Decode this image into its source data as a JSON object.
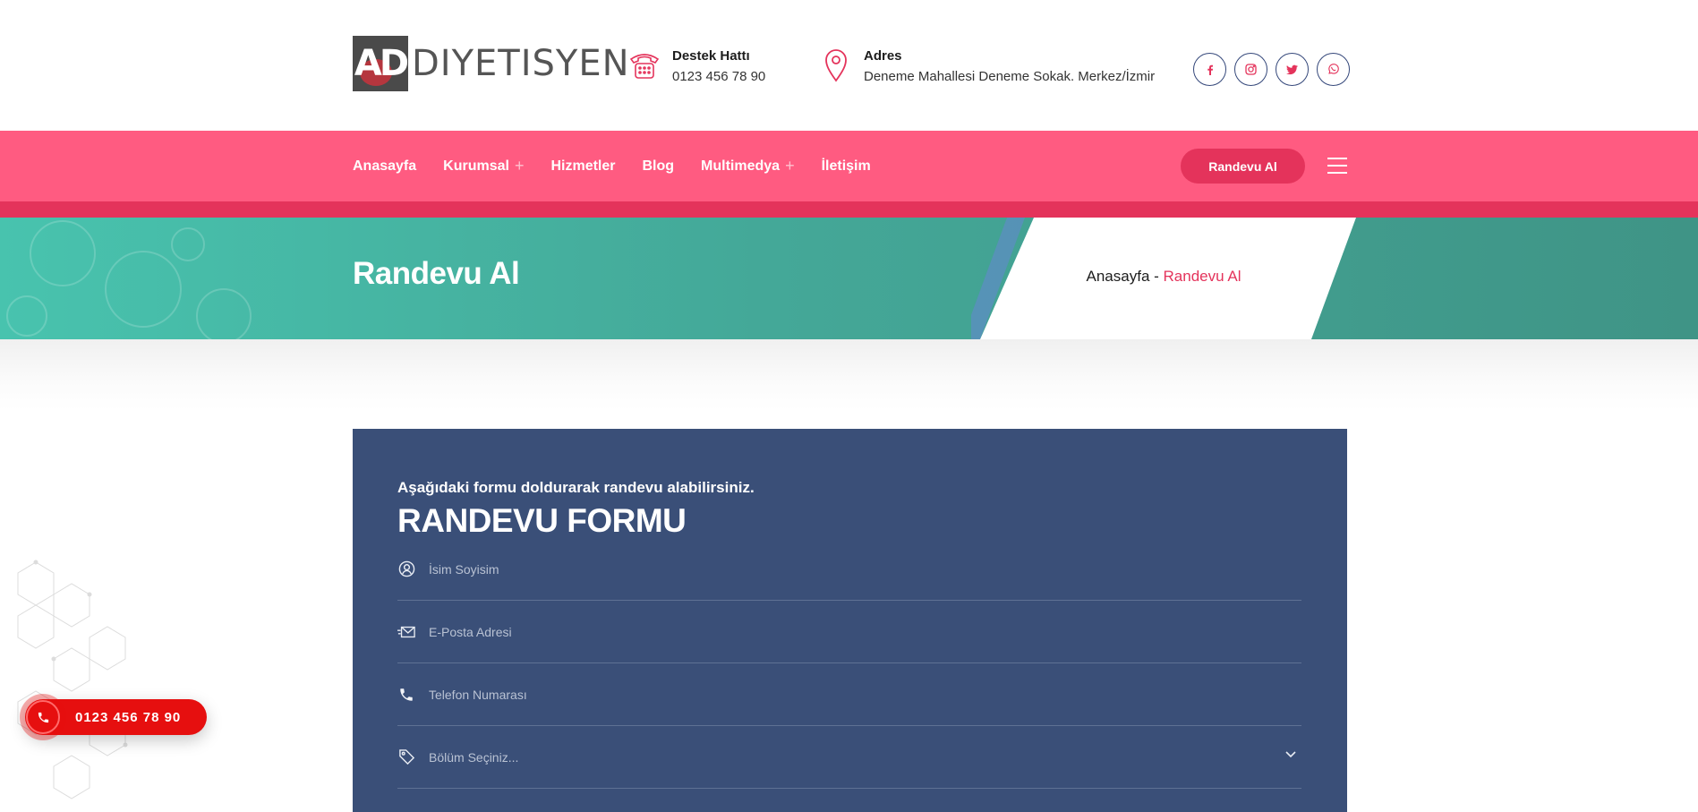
{
  "header": {
    "logo": {
      "mark": "AD",
      "text": "DIYETISYEN"
    },
    "support": {
      "title": "Destek Hattı",
      "value": "0123 456 78 90",
      "icon": "telephone-icon"
    },
    "address": {
      "title": "Adres",
      "value": "Deneme Mahallesi Deneme Sokak. Merkez/İzmir",
      "icon": "location-pin-icon"
    },
    "socials": [
      {
        "name": "facebook-icon",
        "glyph": "f"
      },
      {
        "name": "instagram-icon",
        "glyph": ""
      },
      {
        "name": "twitter-icon",
        "glyph": ""
      },
      {
        "name": "whatsapp-icon",
        "glyph": ""
      }
    ]
  },
  "nav": {
    "items": [
      {
        "label": "Anasayfa",
        "has_submenu": false
      },
      {
        "label": "Kurumsal",
        "has_submenu": true
      },
      {
        "label": "Hizmetler",
        "has_submenu": false
      },
      {
        "label": "Blog",
        "has_submenu": false
      },
      {
        "label": "Multimedya",
        "has_submenu": true
      },
      {
        "label": "İletişim",
        "has_submenu": false
      }
    ],
    "submenu_marker": "+",
    "cta_label": "Randevu Al"
  },
  "banner": {
    "title": "Randevu Al",
    "breadcrumb": {
      "home": "Anasayfa",
      "separator": " - ",
      "current": "Randevu Al"
    }
  },
  "form": {
    "subtitle": "Aşağıdaki formu doldurarak randevu alabilirsiniz.",
    "title": "RANDEVU FORMU",
    "fields": {
      "name": {
        "placeholder": "İsim Soyisim",
        "icon": "user-icon"
      },
      "email": {
        "placeholder": "E-Posta Adresi",
        "icon": "envelope-icon"
      },
      "phone": {
        "placeholder": "Telefon Numarası",
        "icon": "phone-icon"
      },
      "department": {
        "selected": "Bölüm Seçiniz...",
        "icon": "tag-icon"
      }
    }
  },
  "floating_call": {
    "number": "0123 456 78 90"
  },
  "colors": {
    "nav_pink": "#ff5b81",
    "accent_red": "#e4335b",
    "banner_teal": "#44a898",
    "form_navy": "#3a4f78",
    "call_red": "#e60f0f"
  }
}
